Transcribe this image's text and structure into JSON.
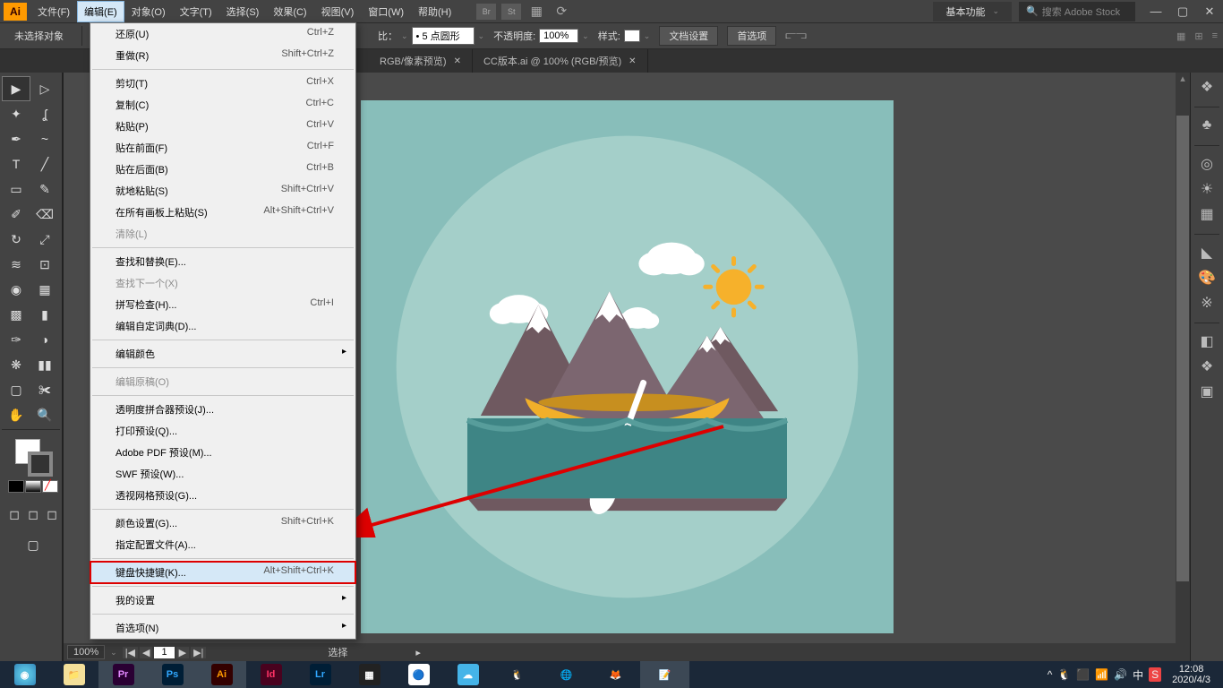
{
  "titlebar": {
    "logo": "Ai",
    "workspace": "基本功能",
    "search_placeholder": "搜索 Adobe Stock"
  },
  "menu": {
    "file": "文件(F)",
    "edit": "编辑(E)",
    "object": "对象(O)",
    "text": "文字(T)",
    "select": "选择(S)",
    "effect": "效果(C)",
    "view": "视图(V)",
    "window": "窗口(W)",
    "help": "帮助(H)"
  },
  "controlbar": {
    "no_selection": "未选择对象",
    "stroke_label": "比：",
    "stroke_style": "5 点圆形",
    "opacity_label": "不透明度:",
    "opacity_value": "100%",
    "style_label": "样式:",
    "doc_setup": "文档设置",
    "prefs": "首选项"
  },
  "tabs": [
    {
      "label": "RGB/像素预览)",
      "close": "✕"
    },
    {
      "label": "CC版本.ai @ 100% (RGB/预览)",
      "close": "✕"
    }
  ],
  "edit_menu": [
    {
      "label": "还原(U)",
      "shortcut": "Ctrl+Z"
    },
    {
      "label": "重做(R)",
      "shortcut": "Shift+Ctrl+Z"
    },
    {
      "sep": true
    },
    {
      "label": "剪切(T)",
      "shortcut": "Ctrl+X"
    },
    {
      "label": "复制(C)",
      "shortcut": "Ctrl+C"
    },
    {
      "label": "粘贴(P)",
      "shortcut": "Ctrl+V"
    },
    {
      "label": "贴在前面(F)",
      "shortcut": "Ctrl+F"
    },
    {
      "label": "贴在后面(B)",
      "shortcut": "Ctrl+B"
    },
    {
      "label": "就地粘贴(S)",
      "shortcut": "Shift+Ctrl+V"
    },
    {
      "label": "在所有画板上粘贴(S)",
      "shortcut": "Alt+Shift+Ctrl+V"
    },
    {
      "label": "清除(L)",
      "disabled": true
    },
    {
      "sep": true
    },
    {
      "label": "查找和替换(E)..."
    },
    {
      "label": "查找下一个(X)",
      "disabled": true
    },
    {
      "label": "拼写检查(H)...",
      "shortcut": "Ctrl+I"
    },
    {
      "label": "编辑自定词典(D)..."
    },
    {
      "sep": true
    },
    {
      "label": "编辑颜色",
      "submenu": true
    },
    {
      "sep": true
    },
    {
      "label": "编辑原稿(O)",
      "disabled": true
    },
    {
      "sep": true
    },
    {
      "label": "透明度拼合器预设(J)..."
    },
    {
      "label": "打印预设(Q)..."
    },
    {
      "label": "Adobe PDF 预设(M)..."
    },
    {
      "label": "SWF 预设(W)..."
    },
    {
      "label": "透视网格预设(G)..."
    },
    {
      "sep": true
    },
    {
      "label": "颜色设置(G)...",
      "shortcut": "Shift+Ctrl+K"
    },
    {
      "label": "指定配置文件(A)..."
    },
    {
      "sep": true
    },
    {
      "label": "键盘快捷键(K)...",
      "shortcut": "Alt+Shift+Ctrl+K",
      "highlighted": true
    },
    {
      "sep": true
    },
    {
      "label": "我的设置",
      "submenu": true
    },
    {
      "sep": true
    },
    {
      "label": "首选项(N)",
      "submenu": true
    }
  ],
  "statusbar": {
    "zoom": "100%",
    "artboard": "1",
    "label": "选择"
  },
  "taskbar": {
    "time": "12:08",
    "date": "2020/4/3"
  }
}
